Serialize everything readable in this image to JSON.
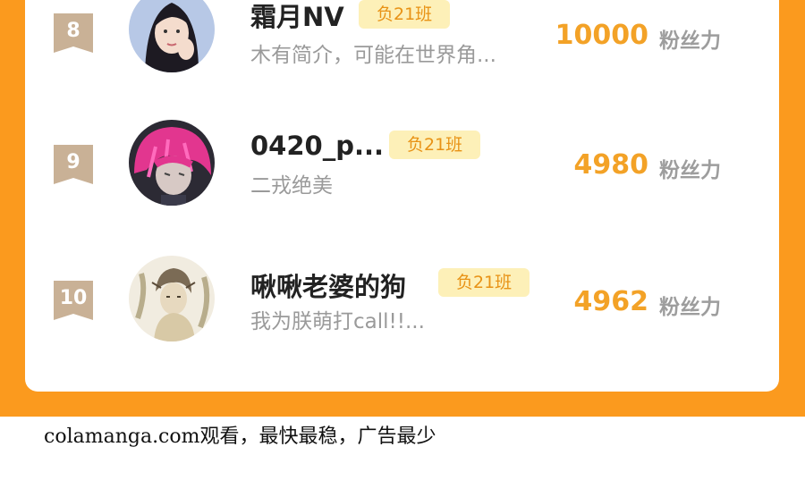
{
  "ranking": [
    {
      "rank": "8",
      "name": "霜月NV",
      "badge": "负21班",
      "bio": "木有简介，可能在世界角...",
      "score": "10000",
      "unit": "粉丝力",
      "avatar_icon": "girl-portrait-avatar"
    },
    {
      "rank": "9",
      "name": "0420_p...",
      "badge": "负21班",
      "bio": "二戎绝美",
      "score": "4980",
      "unit": "粉丝力",
      "avatar_icon": "pink-hair-anime-avatar"
    },
    {
      "rank": "10",
      "name": "啾啾老婆的狗",
      "badge": "负21班",
      "bio": "我为朕萌打call!!...",
      "score": "4962",
      "unit": "粉丝力",
      "avatar_icon": "sketch-character-avatar"
    }
  ],
  "footer": {
    "watermark": "colamanga.com观看，最快最稳，广告最少"
  },
  "colors": {
    "frame": "#fb9a1e",
    "score": "#f3a227",
    "badge_bg": "#fdf0b8",
    "badge_text": "#e89215",
    "rank_badge": "#c9b196"
  }
}
